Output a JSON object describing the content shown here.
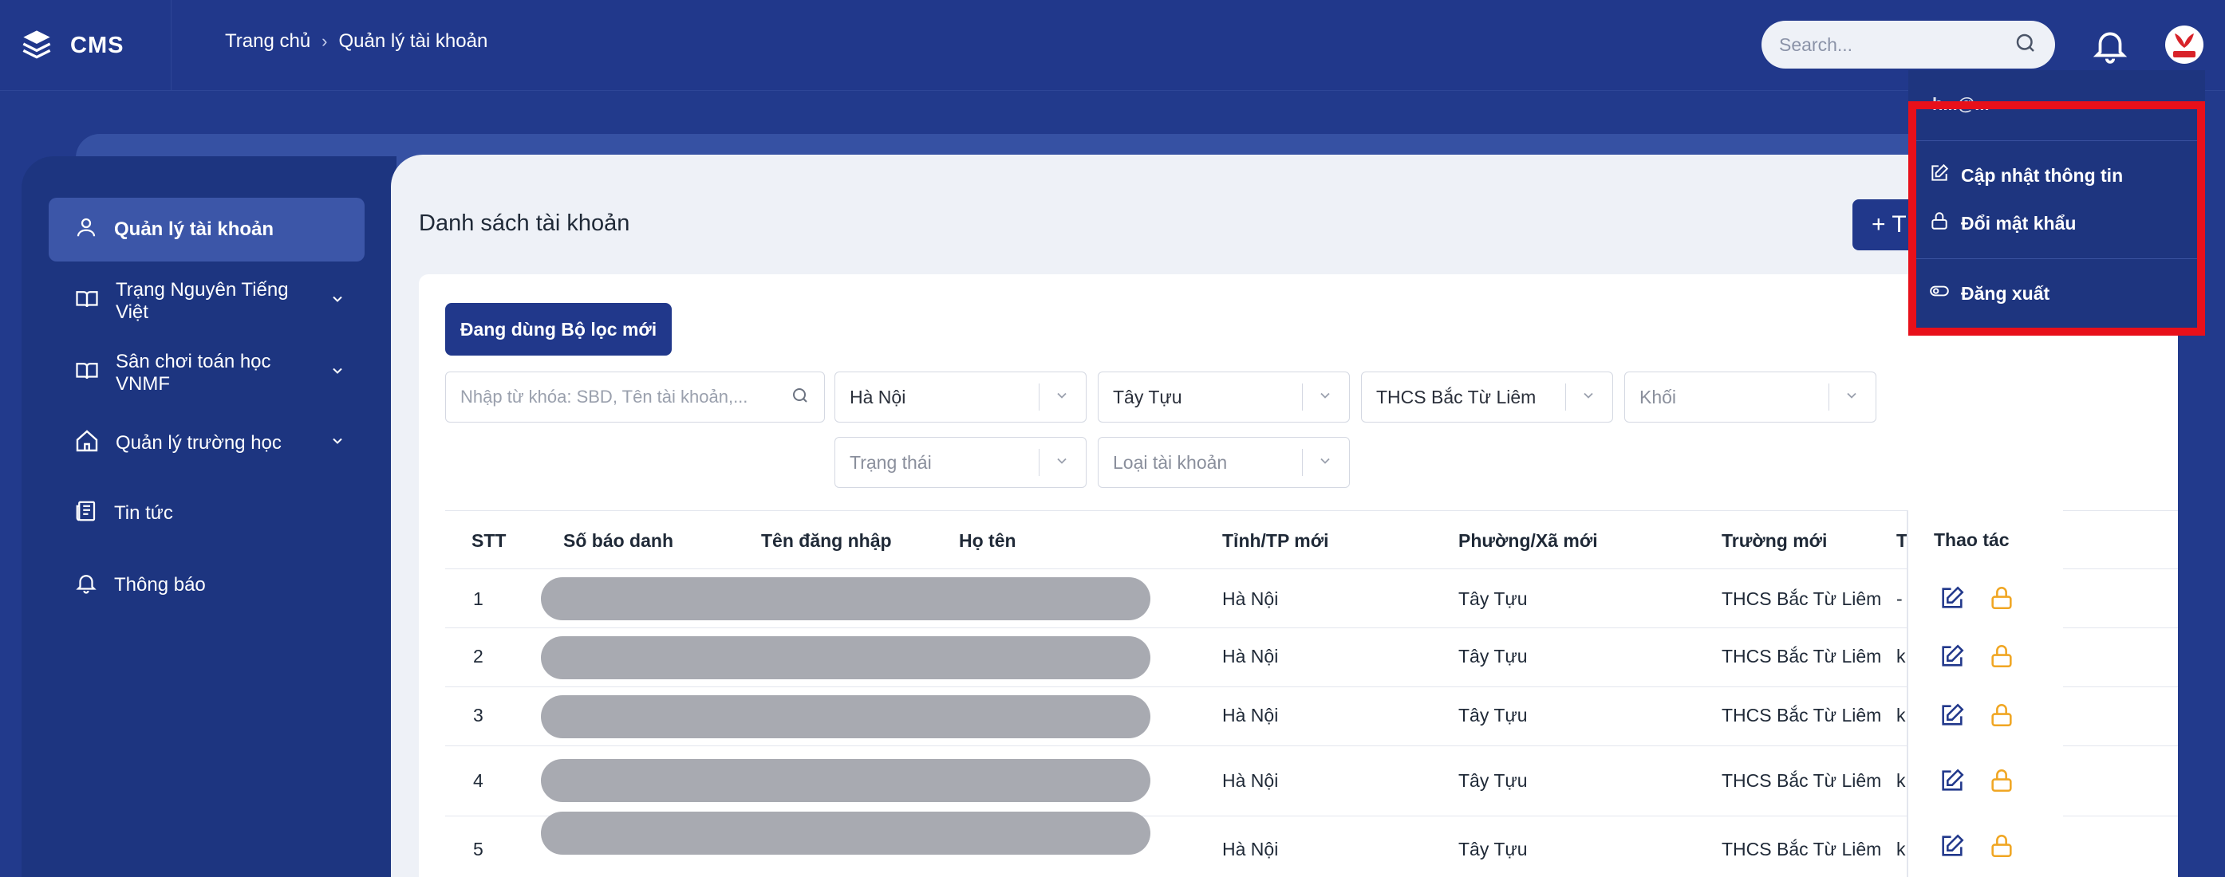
{
  "header": {
    "brand": "CMS",
    "breadcrumb": [
      "Trang chủ",
      "Quản lý tài khoản"
    ],
    "search_placeholder": "Search..."
  },
  "sidebar": {
    "items": [
      {
        "label": "Quản lý tài khoản",
        "icon": "user-icon",
        "active": true,
        "has_chevron": false
      },
      {
        "label": "Trạng Nguyên Tiếng Việt",
        "icon": "book-icon",
        "active": false,
        "has_chevron": true
      },
      {
        "label": "Sân chơi toán học VNMF",
        "icon": "book-icon",
        "active": false,
        "has_chevron": true
      },
      {
        "label": "Quản lý trường học",
        "icon": "home-icon",
        "active": false,
        "has_chevron": true
      },
      {
        "label": "Tin tức",
        "icon": "newspaper-icon",
        "active": false,
        "has_chevron": false
      },
      {
        "label": "Thông báo",
        "icon": "bell-icon",
        "active": false,
        "has_chevron": false
      }
    ]
  },
  "main": {
    "title": "Danh sách tài khoản",
    "add_button": "+ T",
    "filter_button": "Đang dùng Bộ lọc mới",
    "keyword_placeholder": "Nhập từ khóa: SBD, Tên tài khoản,...",
    "filters": {
      "province": "Hà Nội",
      "ward": "Tây Tựu",
      "school": "THCS Bắc Từ Liêm",
      "grade": "Khối",
      "status": "Trạng thái",
      "account_type": "Loại tài khoản"
    },
    "table": {
      "headers": [
        "STT",
        "Số báo danh",
        "Tên đăng nhập",
        "Họ tên",
        "Tỉnh/TP mới",
        "Phường/Xã mới",
        "Trường mới",
        "T",
        "Thao tác"
      ],
      "rows": [
        {
          "stt": "1",
          "province": "Hà Nội",
          "ward": "Tây Tựu",
          "school": "THCS Bắc Từ Liêm",
          "extra": "-"
        },
        {
          "stt": "2",
          "province": "Hà Nội",
          "ward": "Tây Tựu",
          "school": "THCS Bắc Từ Liêm",
          "extra": "k"
        },
        {
          "stt": "3",
          "province": "Hà Nội",
          "ward": "Tây Tựu",
          "school": "THCS Bắc Từ Liêm",
          "extra": "k"
        },
        {
          "stt": "4",
          "province": "Hà Nội",
          "ward": "Tây Tựu",
          "school": "THCS Bắc Từ Liêm",
          "extra": "k"
        },
        {
          "stt": "5",
          "province": "Hà Nội",
          "ward": "Tây Tựu",
          "school": "THCS Bắc Từ Liêm",
          "extra": "k"
        }
      ]
    }
  },
  "user_menu": {
    "email": "h...@...",
    "items": [
      {
        "label": "Cập nhật thông tin",
        "icon": "edit-icon"
      },
      {
        "label": "Đổi mật khẩu",
        "icon": "lock-icon"
      },
      {
        "label": "Đăng xuất",
        "icon": "toggle-icon"
      }
    ]
  },
  "colors": {
    "primary": "#21388b",
    "highlight": "#e8101a",
    "lock_icon": "#f0a623"
  }
}
